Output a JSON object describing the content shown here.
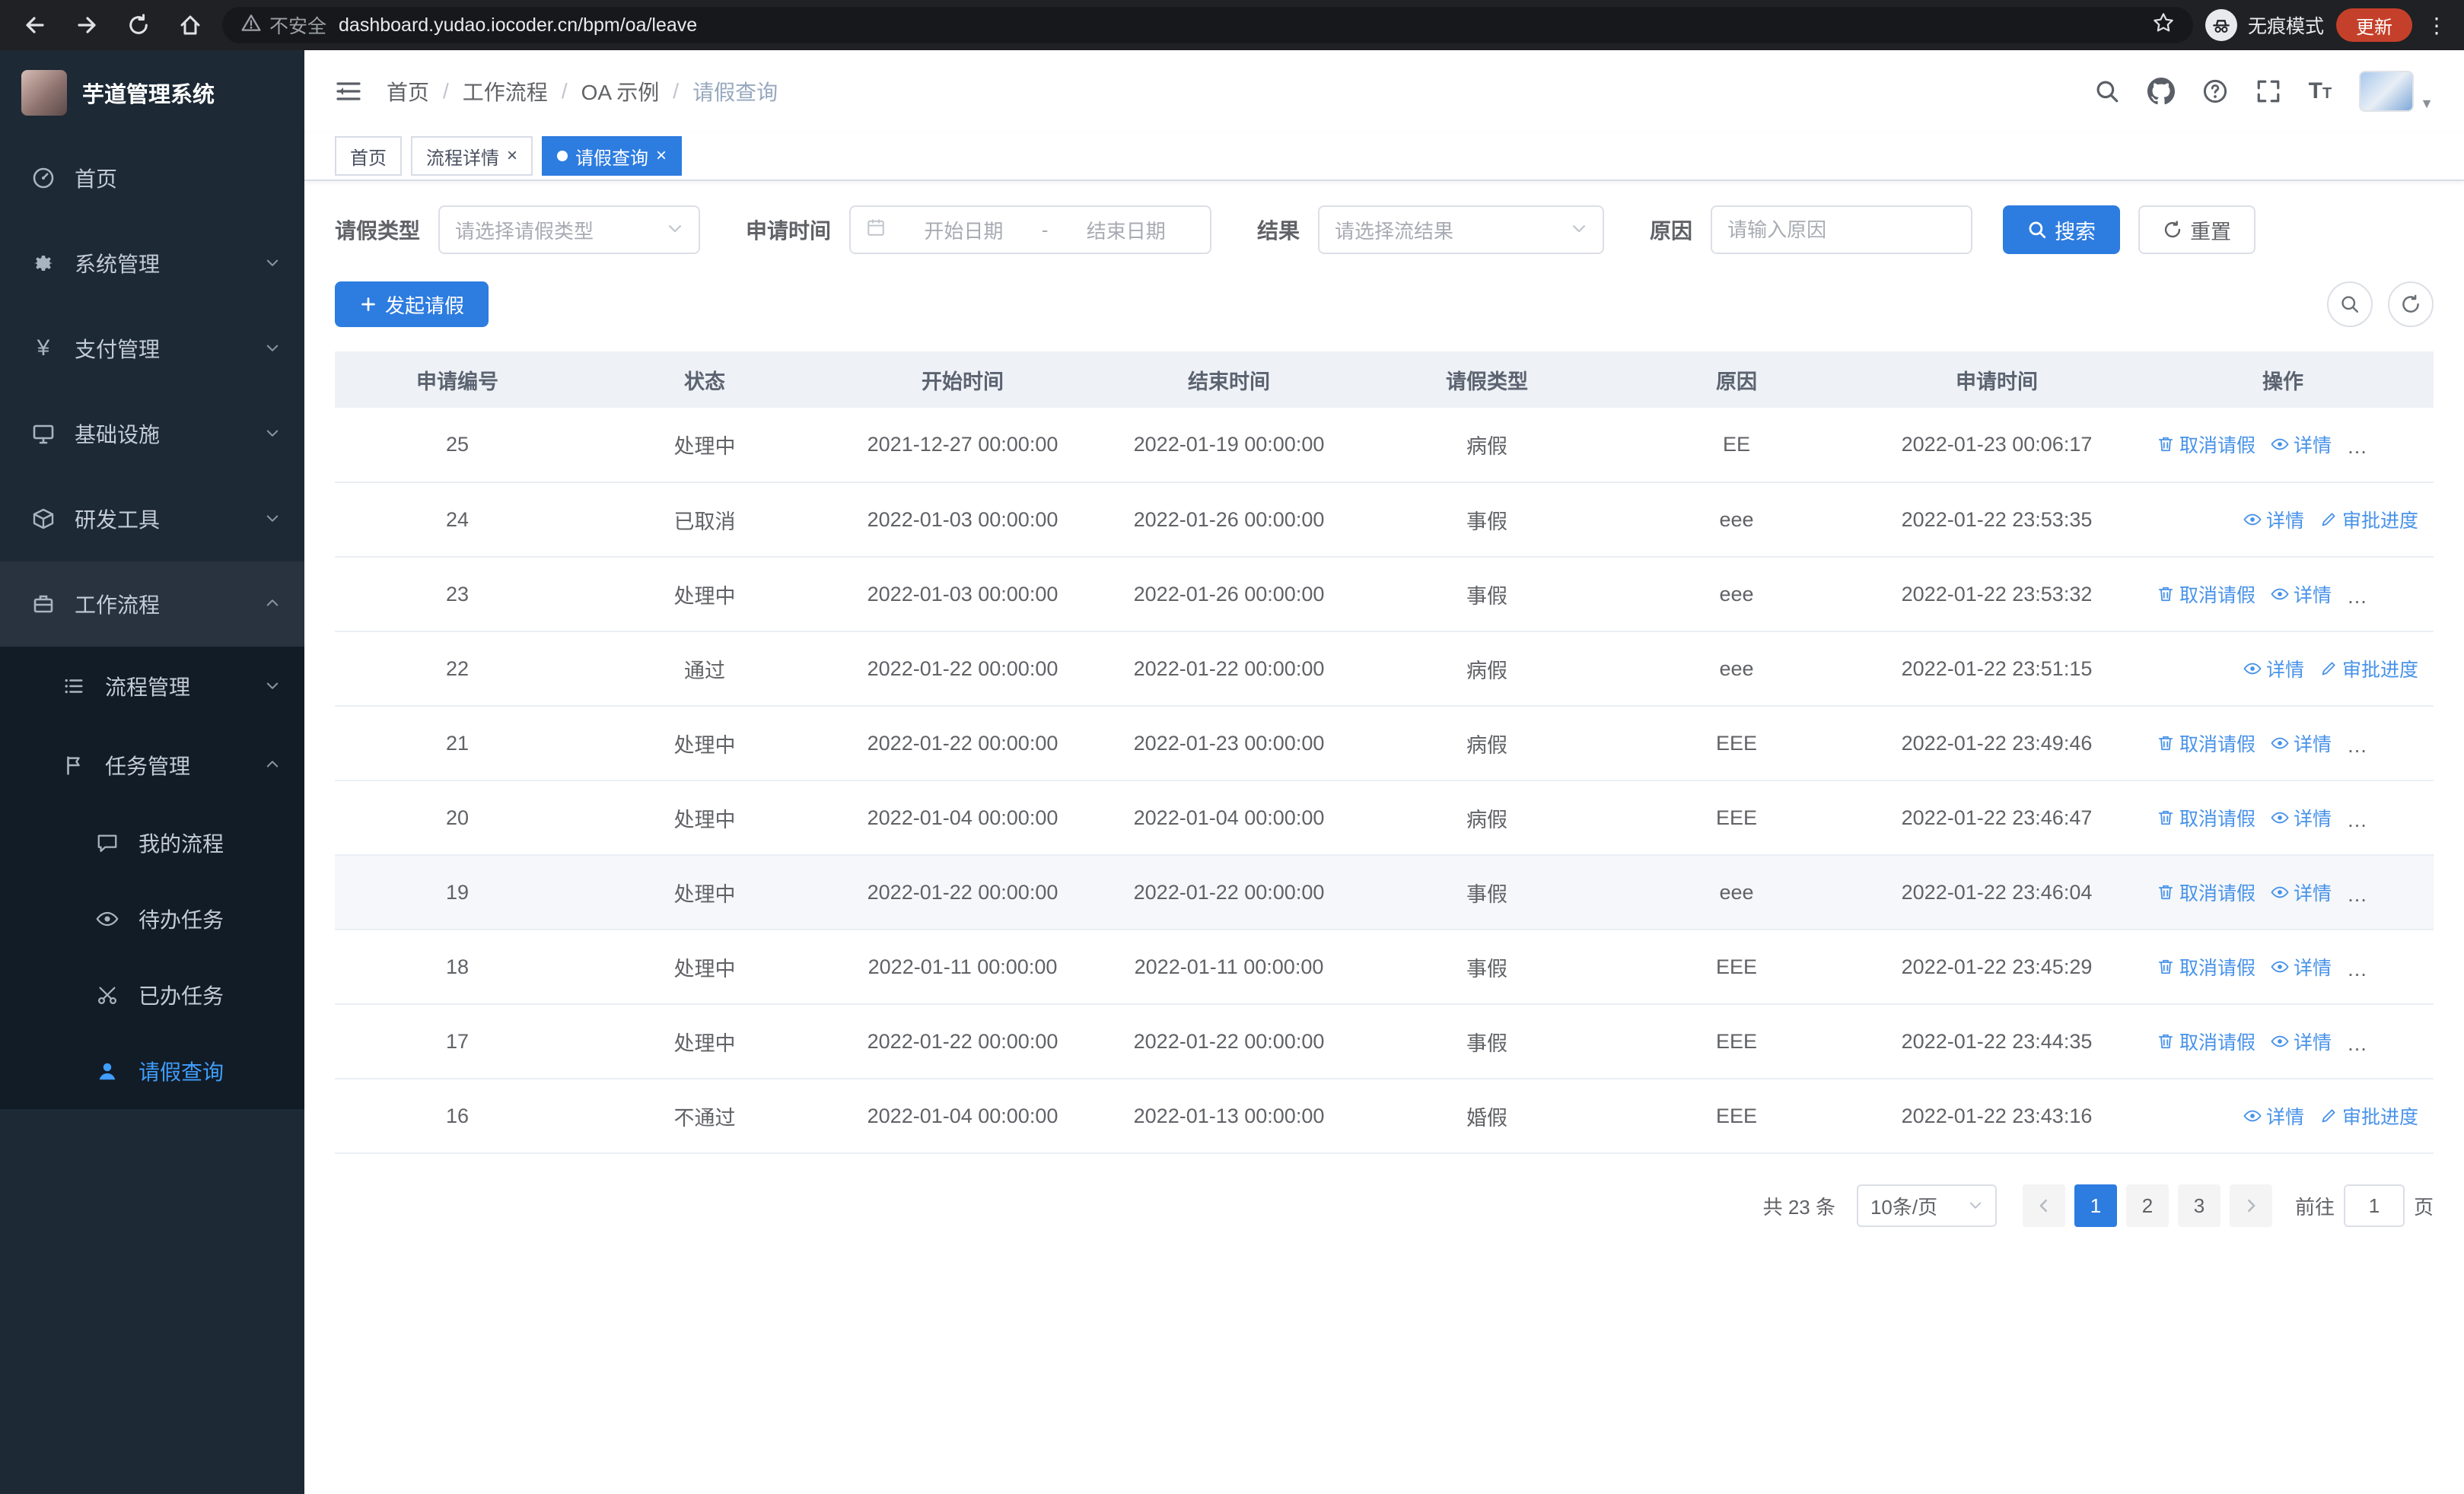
{
  "colors": {
    "primary": "#2d7ce0",
    "link": "#4792e9",
    "sidebar_bg": "#1d2935",
    "submenu_bg": "#121c26",
    "active_menu": "#409eff"
  },
  "browser": {
    "security_warning": "不安全",
    "url": "dashboard.yudao.iocoder.cn/bpm/oa/leave",
    "incognito_label": "无痕模式",
    "update_label": "更新"
  },
  "sidebar": {
    "logo_title": "芋道管理系统",
    "home": "首页",
    "system": "系统管理",
    "payment": "支付管理",
    "infra": "基础设施",
    "devtools": "研发工具",
    "workflow": "工作流程",
    "process_mgmt": "流程管理",
    "task_mgmt": "任务管理",
    "my_process": "我的流程",
    "todo_tasks": "待办任务",
    "done_tasks": "已办任务",
    "leave_query": "请假查询"
  },
  "header": {
    "breadcrumb": [
      "首页",
      "工作流程",
      "OA 示例",
      "请假查询"
    ]
  },
  "tabs": {
    "home": "首页",
    "process_detail": "流程详情",
    "leave_query": "请假查询"
  },
  "filters": {
    "leave_type_label": "请假类型",
    "leave_type_placeholder": "请选择请假类型",
    "apply_time_label": "申请时间",
    "start_date_placeholder": "开始日期",
    "range_separator": "-",
    "end_date_placeholder": "结束日期",
    "result_label": "结果",
    "result_placeholder": "请选择流结果",
    "reason_label": "原因",
    "reason_placeholder": "请输入原因",
    "search_label": "搜索",
    "reset_label": "重置"
  },
  "toolbar": {
    "create_label": "发起请假"
  },
  "table": {
    "columns": [
      "申请编号",
      "状态",
      "开始时间",
      "结束时间",
      "请假类型",
      "原因",
      "申请时间",
      "操作"
    ],
    "action_labels": {
      "cancel": "取消请假",
      "detail": "详情",
      "progress": "审批进度"
    },
    "rows": [
      {
        "id": "25",
        "status": "处理中",
        "start": "2021-12-27 00:00:00",
        "end": "2022-01-19 00:00:00",
        "type": "病假",
        "reason": "EE",
        "applied": "2022-01-23 00:06:17",
        "actions": [
          "cancel",
          "detail",
          "progress"
        ],
        "highlight": false
      },
      {
        "id": "24",
        "status": "已取消",
        "start": "2022-01-03 00:00:00",
        "end": "2022-01-26 00:00:00",
        "type": "事假",
        "reason": "eee",
        "applied": "2022-01-22 23:53:35",
        "actions": [
          "detail",
          "progress"
        ],
        "highlight": false
      },
      {
        "id": "23",
        "status": "处理中",
        "start": "2022-01-03 00:00:00",
        "end": "2022-01-26 00:00:00",
        "type": "事假",
        "reason": "eee",
        "applied": "2022-01-22 23:53:32",
        "actions": [
          "cancel",
          "detail",
          "progress"
        ],
        "highlight": false
      },
      {
        "id": "22",
        "status": "通过",
        "start": "2022-01-22 00:00:00",
        "end": "2022-01-22 00:00:00",
        "type": "病假",
        "reason": "eee",
        "applied": "2022-01-22 23:51:15",
        "actions": [
          "detail",
          "progress"
        ],
        "highlight": false
      },
      {
        "id": "21",
        "status": "处理中",
        "start": "2022-01-22 00:00:00",
        "end": "2022-01-23 00:00:00",
        "type": "病假",
        "reason": "EEE",
        "applied": "2022-01-22 23:49:46",
        "actions": [
          "cancel",
          "detail",
          "progress"
        ],
        "highlight": false
      },
      {
        "id": "20",
        "status": "处理中",
        "start": "2022-01-04 00:00:00",
        "end": "2022-01-04 00:00:00",
        "type": "病假",
        "reason": "EEE",
        "applied": "2022-01-22 23:46:47",
        "actions": [
          "cancel",
          "detail",
          "progress"
        ],
        "highlight": false
      },
      {
        "id": "19",
        "status": "处理中",
        "start": "2022-01-22 00:00:00",
        "end": "2022-01-22 00:00:00",
        "type": "事假",
        "reason": "eee",
        "applied": "2022-01-22 23:46:04",
        "actions": [
          "cancel",
          "detail",
          "progress"
        ],
        "highlight": true
      },
      {
        "id": "18",
        "status": "处理中",
        "start": "2022-01-11 00:00:00",
        "end": "2022-01-11 00:00:00",
        "type": "事假",
        "reason": "EEE",
        "applied": "2022-01-22 23:45:29",
        "actions": [
          "cancel",
          "detail",
          "progress"
        ],
        "highlight": false
      },
      {
        "id": "17",
        "status": "处理中",
        "start": "2022-01-22 00:00:00",
        "end": "2022-01-22 00:00:00",
        "type": "事假",
        "reason": "EEE",
        "applied": "2022-01-22 23:44:35",
        "actions": [
          "cancel",
          "detail",
          "progress"
        ],
        "highlight": false
      },
      {
        "id": "16",
        "status": "不通过",
        "start": "2022-01-04 00:00:00",
        "end": "2022-01-13 00:00:00",
        "type": "婚假",
        "reason": "EEE",
        "applied": "2022-01-22 23:43:16",
        "actions": [
          "detail",
          "progress"
        ],
        "highlight": false
      }
    ]
  },
  "pagination": {
    "total_text": "共 23 条",
    "page_size": "10条/页",
    "pages": [
      "1",
      "2",
      "3"
    ],
    "active_page": "1",
    "goto_prefix": "前往",
    "goto_value": "1",
    "goto_suffix": "页"
  }
}
